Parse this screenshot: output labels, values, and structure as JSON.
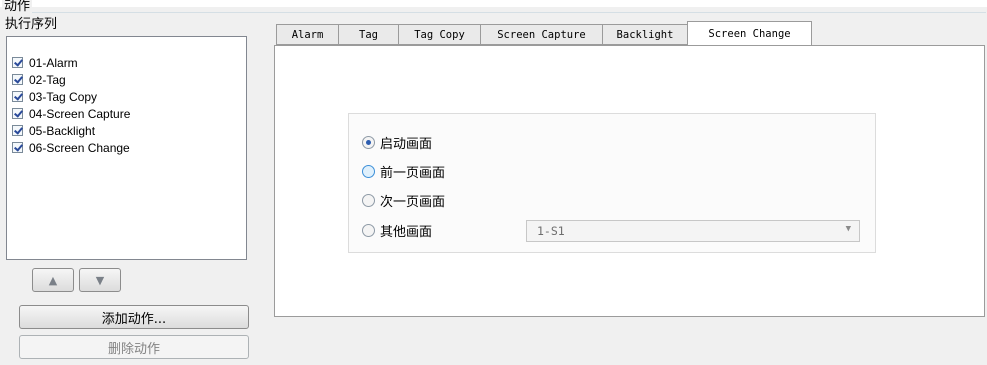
{
  "group": {
    "title": "动作"
  },
  "sequence": {
    "label": "执行序列",
    "items": [
      {
        "label": "01-Alarm",
        "checked": true
      },
      {
        "label": "02-Tag",
        "checked": true
      },
      {
        "label": "03-Tag Copy",
        "checked": true
      },
      {
        "label": "04-Screen Capture",
        "checked": true
      },
      {
        "label": "05-Backlight",
        "checked": true
      },
      {
        "label": "06-Screen Change",
        "checked": true
      }
    ],
    "move_up_icon": "up-arrow",
    "move_down_icon": "down-arrow",
    "add_button": "添加动作...",
    "delete_button": "删除动作"
  },
  "tabs": [
    "Alarm",
    "Tag",
    "Tag Copy",
    "Screen Capture",
    "Backlight",
    "Screen Change"
  ],
  "active_tab": "Screen Change",
  "screen_change": {
    "options": [
      {
        "label": "启动画面",
        "selected": true
      },
      {
        "label": "前一页画面",
        "selected": false
      },
      {
        "label": "次一页画面",
        "selected": false
      },
      {
        "label": "其他画面",
        "selected": false
      }
    ],
    "other_screen_value": "1-S1"
  },
  "colors": {
    "accent": "#2c5db0",
    "tab_border": "#9b9b9b"
  }
}
